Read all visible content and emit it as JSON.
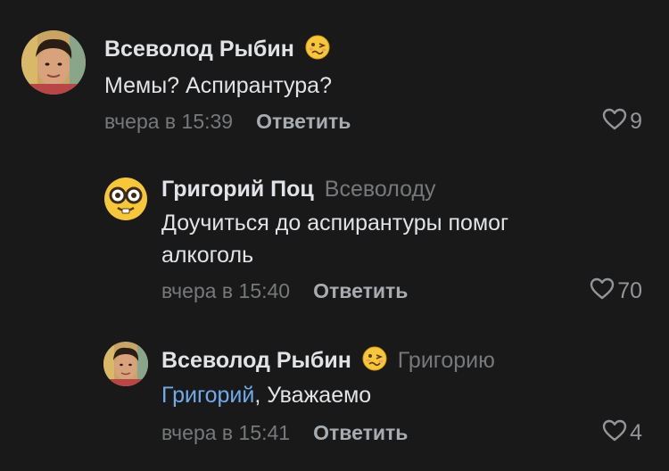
{
  "comments": [
    {
      "author": "Всеволод Рыбин",
      "reply_to": "",
      "mention": "",
      "text": "Мемы? Аспирантура?",
      "time": "вчера в 15:39",
      "reply_label": "Ответить",
      "likes": "9",
      "avatar_icon": "user-photo-avatar",
      "emoji_icon": "woozy-face-emoji"
    },
    {
      "author": "Григорий Поц",
      "reply_to": "Всеволоду",
      "mention": "",
      "text": "Доучиться до аспирантуры помог алкоголь",
      "time": "вчера в 15:40",
      "reply_label": "Ответить",
      "likes": "70",
      "avatar_icon": "nerd-face-emoji-avatar",
      "emoji_icon": ""
    },
    {
      "author": "Всеволод Рыбин",
      "reply_to": "Григорию",
      "mention": "Григорий",
      "text": ", Уважаемо",
      "time": "вчера в 15:41",
      "reply_label": "Ответить",
      "likes": "4",
      "avatar_icon": "user-photo-avatar",
      "emoji_icon": "woozy-face-emoji"
    }
  ],
  "colors": {
    "background": "#19191a",
    "text": "#e1e3e6",
    "secondary": "#76787a",
    "link": "#71aaeb"
  }
}
